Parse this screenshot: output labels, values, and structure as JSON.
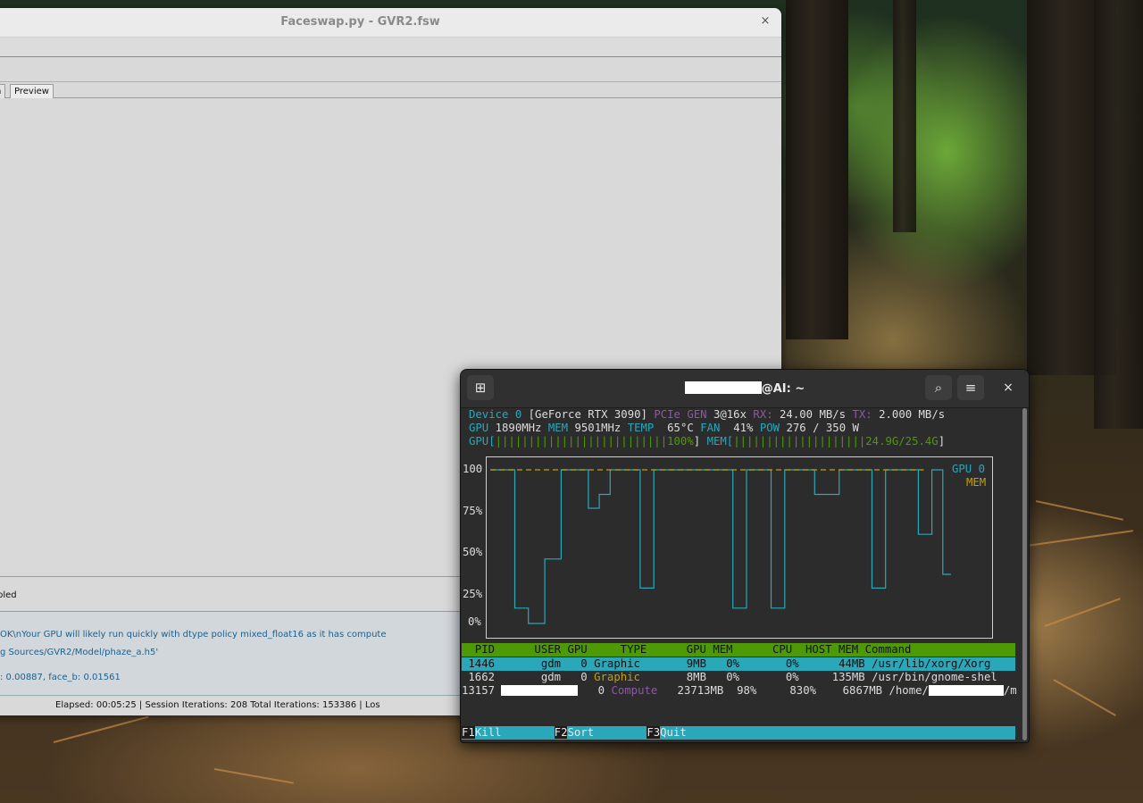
{
  "faceswap": {
    "title": "Faceswap.py - GVR2.fsw",
    "close_glyph": "×",
    "tabs": [
      {
        "label": "h"
      },
      {
        "label": "Preview"
      }
    ],
    "status_text": "bled",
    "console_lines": [
      "OK\\nYour GPU will likely run quickly with dtype policy mixed_float16 as it has compute",
      "g Sources/GVR2/Model/phaze_a.h5'",
      ": 0.00887, face_b: 0.01561"
    ],
    "footer_text": "Elapsed: 00:05:25 | Session Iterations: 208  Total Iterations: 153386 | Los"
  },
  "terminal": {
    "title_suffix": "@AI: ~",
    "new_tab_glyph": "⊞",
    "search_glyph": "⌕",
    "menu_glyph": "≡",
    "close_glyph": "×",
    "device": {
      "label": "Device 0",
      "name": "[GeForce RTX 3090]",
      "pcie_label": "PCIe",
      "gen_label": "GEN",
      "gen_value": "3@16x",
      "rx_label": "RX:",
      "rx_value": "24.00 MB/s",
      "tx_label": "TX:",
      "tx_value": "2.000 MB/s",
      "gpu_label": "GPU",
      "gpu_clock": "1890MHz",
      "mem_label": "MEM",
      "mem_clock": "9501MHz",
      "temp_label": "TEMP",
      "temp_value": "65",
      "temp_unit": "°C",
      "fan_label": "FAN",
      "fan_value": "41%",
      "pow_label": "POW",
      "pow_value": "276 / 350 W",
      "gpu_bar_label": "GPU[",
      "gpu_bar": "||||||||||||||||||||||||||",
      "gpu_pct": "100%",
      "gpu_bar_close": "]",
      "mem_bar_label": "MEM[",
      "mem_bar": "||||||||||||||||||||",
      "mem_usage": "24.9G/25.4G",
      "mem_bar_close": "]"
    },
    "chart_data": {
      "type": "line",
      "y_ticks": [
        "100",
        "75%",
        "50%",
        "25%",
        "0%"
      ],
      "ylim": [
        0,
        100
      ],
      "legend": [
        {
          "name": "GPU 0",
          "color": "#2aa7b8"
        },
        {
          "name": "MEM",
          "color": "#c4a000"
        }
      ],
      "series": [
        {
          "name": "GPU 0",
          "points": [
            [
              0,
              100
            ],
            [
              18,
              100
            ],
            [
              18,
              10
            ],
            [
              28,
              10
            ],
            [
              28,
              0
            ],
            [
              40,
              0
            ],
            [
              40,
              42
            ],
            [
              52,
              42
            ],
            [
              52,
              100
            ],
            [
              72,
              100
            ],
            [
              72,
              75
            ],
            [
              80,
              75
            ],
            [
              80,
              84
            ],
            [
              88,
              84
            ],
            [
              88,
              100
            ],
            [
              110,
              100
            ],
            [
              110,
              23
            ],
            [
              120,
              23
            ],
            [
              120,
              100
            ],
            [
              178,
              100
            ],
            [
              178,
              10
            ],
            [
              188,
              10
            ],
            [
              188,
              100
            ],
            [
              206,
              100
            ],
            [
              206,
              10
            ],
            [
              216,
              10
            ],
            [
              216,
              100
            ],
            [
              238,
              100
            ],
            [
              238,
              84
            ],
            [
              256,
              84
            ],
            [
              256,
              100
            ],
            [
              280,
              100
            ],
            [
              280,
              23
            ],
            [
              290,
              23
            ],
            [
              290,
              100
            ],
            [
              314,
              100
            ],
            [
              314,
              58
            ],
            [
              324,
              58
            ],
            [
              324,
              100
            ],
            [
              332,
              100
            ],
            [
              332,
              32
            ],
            [
              338,
              32
            ]
          ]
        },
        {
          "name": "MEM",
          "points": [
            [
              0,
              100
            ],
            [
              318,
              100
            ]
          ]
        }
      ],
      "x_range": [
        0,
        338
      ]
    },
    "processes": {
      "header": "  PID      USER GPU     TYPE      GPU MEM      CPU  HOST MEM Command",
      "rows": [
        {
          "pid": " 1446",
          "user": "gdm",
          "gpu": "0",
          "type": "Graphic",
          "gpu_mem": "9MB",
          "gpu_mem_pct": "0%",
          "cpu": "0%",
          "host_mem": "44MB",
          "command": "/usr/lib/xorg/Xorg"
        },
        {
          "pid": " 1662",
          "user": "gdm",
          "gpu": "0",
          "type": "Graphic",
          "gpu_mem": "8MB",
          "gpu_mem_pct": "0%",
          "cpu": "0%",
          "host_mem": "135MB",
          "command": "/usr/bin/gnome-shel"
        },
        {
          "pid": "13157",
          "user": "",
          "gpu": "0",
          "type": "Compute",
          "gpu_mem": "23713MB",
          "gpu_mem_pct": "98%",
          "cpu": "830%",
          "host_mem": "6867MB",
          "command_prefix": "/home/",
          "command_suffix": "/m"
        }
      ]
    },
    "fkeys": [
      {
        "key": "F1",
        "label": "Kill"
      },
      {
        "key": "F2",
        "label": "Sort"
      },
      {
        "key": "F3",
        "label": "Quit"
      }
    ]
  }
}
